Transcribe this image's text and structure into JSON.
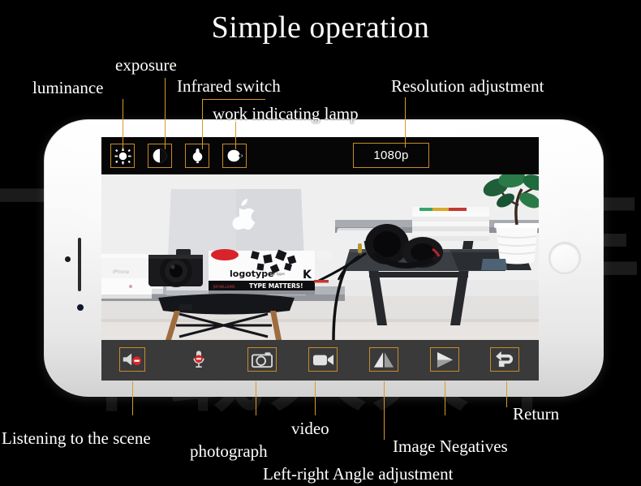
{
  "page": {
    "title": "Simple operation",
    "background_color": "#000000",
    "accent_color": "#d99a28",
    "watermark_text": "下载人人车"
  },
  "device": {
    "type": "smartphone-landscape",
    "body_color": "#fcfcfc",
    "home_button": "home-button"
  },
  "screen": {
    "top_toolbar": {
      "buttons": [
        {
          "name": "luminance",
          "icon": "sun-icon",
          "framed": true
        },
        {
          "name": "exposure",
          "icon": "contrast-half-circle-icon",
          "framed": true
        },
        {
          "name": "work-indicating-lamp",
          "icon": "light-bulb-icon",
          "framed": true
        },
        {
          "name": "infrared-switch",
          "icon": "infrared-lamp-icon",
          "framed": true
        }
      ],
      "resolution": {
        "label": "1080p",
        "name": "resolution-adjustment",
        "framed": true
      }
    },
    "preview": {
      "description": "desk with laptop, camera, books, headphones and plant",
      "alt": "camera live preview"
    },
    "bottom_toolbar": {
      "buttons": [
        {
          "name": "listening-to-the-scene",
          "icon": "speaker-muted-icon",
          "framed": true
        },
        {
          "name": "microphone",
          "icon": "microphone-muted-icon",
          "framed": false
        },
        {
          "name": "photograph",
          "icon": "camera-icon",
          "framed": true
        },
        {
          "name": "video",
          "icon": "video-camera-icon",
          "framed": true
        },
        {
          "name": "image-negatives",
          "icon": "mirror-triangles-icon",
          "framed": true
        },
        {
          "name": "left-right-angle-adjustment",
          "icon": "triangle-right-icon",
          "framed": true
        },
        {
          "name": "return",
          "icon": "return-arrow-icon",
          "framed": true
        }
      ]
    }
  },
  "callouts": {
    "top": [
      {
        "id": "luminance",
        "label": "luminance"
      },
      {
        "id": "exposure",
        "label": "exposure"
      },
      {
        "id": "infrared_switch",
        "label": "Infrared switch"
      },
      {
        "id": "work_indicating_lamp",
        "label": "work indicating lamp"
      },
      {
        "id": "resolution_adjustment",
        "label": "Resolution adjustment"
      }
    ],
    "bottom": [
      {
        "id": "listening",
        "label": "Listening to the scene"
      },
      {
        "id": "photograph",
        "label": "photograph"
      },
      {
        "id": "video",
        "label": "video"
      },
      {
        "id": "left_right_angle",
        "label": "Left-right Angle adjustment"
      },
      {
        "id": "image_negatives",
        "label": "Image Negatives"
      },
      {
        "id": "return",
        "label": "Return"
      }
    ]
  }
}
